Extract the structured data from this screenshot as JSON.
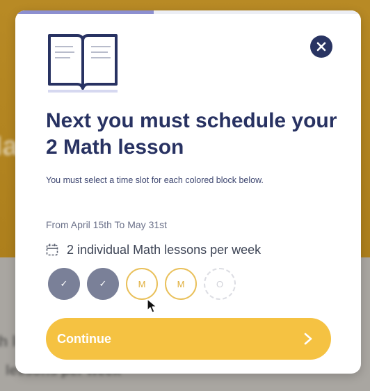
{
  "background": {
    "text_lines": [
      "Math",
      "Math lessons",
      "lessons per week"
    ]
  },
  "modal": {
    "progress_fraction": 0.4,
    "title": "Next you must schedule your 2 Math lesson",
    "subtitle": "You must select a time slot for each colored block below.",
    "date_range": "From April 15th To May 31st",
    "lessons_info": "2 individual Math lessons per week",
    "slots": [
      {
        "state": "done",
        "label": "✓"
      },
      {
        "state": "done",
        "label": "✓"
      },
      {
        "state": "todo",
        "label": "M"
      },
      {
        "state": "todo",
        "label": "M"
      },
      {
        "state": "empty",
        "label": "O"
      }
    ],
    "continue_label": "Continue"
  },
  "colors": {
    "title": "#283262",
    "accent_yellow": "#f5c242",
    "close_button": "#293462",
    "completed_slot": "#7a8098",
    "progress": "#8c8fd0"
  }
}
